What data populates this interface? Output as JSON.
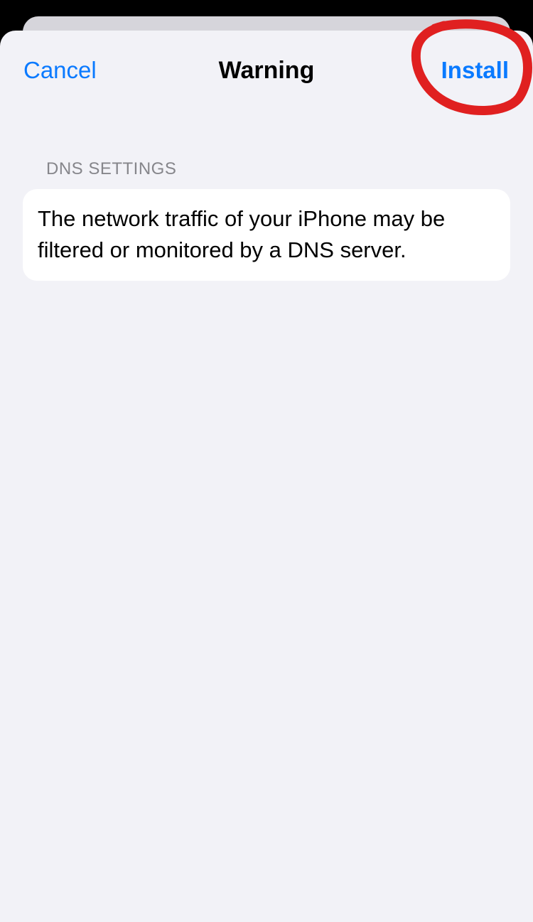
{
  "colors": {
    "accent": "#0a7aff",
    "sheet_background": "#f2f2f7",
    "card_background": "#ffffff",
    "section_header": "#86868b",
    "annotation_red": "#e02020"
  },
  "nav": {
    "cancel_label": "Cancel",
    "title": "Warning",
    "install_label": "Install"
  },
  "section": {
    "header": "DNS SETTINGS",
    "body": "The network traffic of your iPhone may be filtered or monitored by a DNS server."
  }
}
